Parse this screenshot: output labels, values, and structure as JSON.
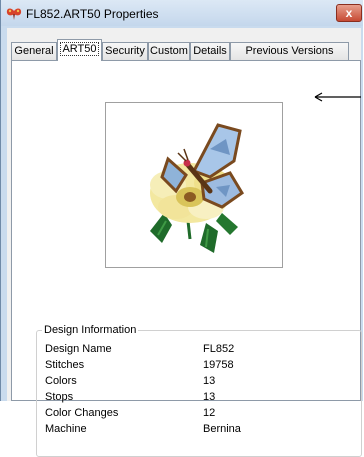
{
  "window": {
    "title": "FL852.ART50 Properties",
    "close_label": "x"
  },
  "tabs": [
    {
      "label": "General",
      "active": false
    },
    {
      "label": "ART50",
      "active": true
    },
    {
      "label": "Security",
      "active": false
    },
    {
      "label": "Custom",
      "active": false
    },
    {
      "label": "Details",
      "active": false
    },
    {
      "label": "Previous Versions",
      "active": false
    }
  ],
  "preview": {
    "icon": "butterfly-on-flower-design"
  },
  "design_info": {
    "group_title": "Design Information",
    "rows": [
      {
        "label": "Design Name",
        "value": "FL852"
      },
      {
        "label": "Stitches",
        "value": "19758"
      },
      {
        "label": "Colors",
        "value": "13"
      },
      {
        "label": "Stops",
        "value": "13"
      },
      {
        "label": "Color Changes",
        "value": "12"
      },
      {
        "label": "Machine",
        "value": "Bernina"
      }
    ]
  },
  "colors": {
    "title_bar": "#c9dbee",
    "close_button": "#c64a34",
    "tab_border": "#8e9aa8",
    "panel_bg": "#ffffff"
  }
}
